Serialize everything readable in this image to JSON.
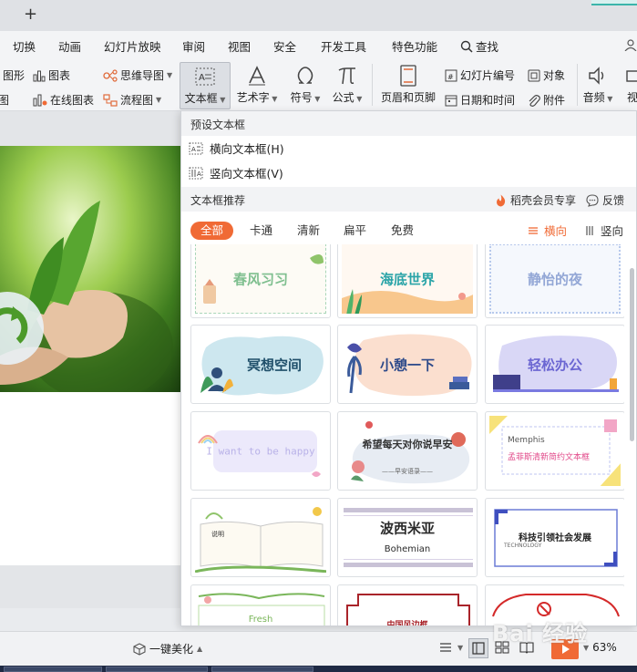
{
  "titlebar": {
    "new_tab": "+"
  },
  "menu": {
    "items": [
      "切换",
      "动画",
      "幻灯片放映",
      "审阅",
      "视图",
      "安全",
      "开发工具",
      "特色功能"
    ],
    "search": "查找"
  },
  "ribbon": {
    "shape": "图形",
    "chart": "图表",
    "smart": "图",
    "online_chart": "在线图表",
    "mindmap": "思维导图",
    "flowchart": "流程图",
    "textbox": "文本框",
    "wordart": "艺术字",
    "symbol": "符号",
    "formula": "公式",
    "header_footer": "页眉和页脚",
    "slide_number": "幻灯片编号",
    "object": "对象",
    "datetime": "日期和时间",
    "attachment": "附件",
    "audio": "音频",
    "video": "视"
  },
  "dropdown": {
    "preset_header": "预设文本框",
    "horizontal": "横向文本框(H)",
    "vertical": "竖向文本框(V)",
    "recommend_header": "文本框推荐",
    "member": "稻壳会员专享",
    "feedback": "反馈",
    "filters": [
      "全部",
      "卡通",
      "清新",
      "扁平",
      "免费"
    ],
    "orient_h": "横向",
    "orient_v": "竖向"
  },
  "cards": [
    {
      "title": "春风习习"
    },
    {
      "title": "海底世界"
    },
    {
      "title": "静怡的夜"
    },
    {
      "title": "冥想空间"
    },
    {
      "title": "小憩一下"
    },
    {
      "title": "轻松办公"
    },
    {
      "title": "I want to be happy"
    },
    {
      "title": "希望每天对你说早安",
      "sub": "——早安语录——"
    },
    {
      "title": "Memphis",
      "sub": "孟菲斯清新简约文本框"
    },
    {
      "title": "说明"
    },
    {
      "title": "波西米亚",
      "sub": "Bohemian"
    },
    {
      "title": "科技引领社会发展",
      "sub": "TECHNOLOGY"
    },
    {
      "title": "Fresh"
    },
    {
      "title": "中国风边框"
    },
    {
      "title": ""
    }
  ],
  "statusbar": {
    "beautify": "一键美化",
    "zoom": "63%"
  },
  "watermark": "Bai 经验",
  "colors": {
    "accent": "#f06a35",
    "ribbon_bg": "#f3f4f6"
  }
}
